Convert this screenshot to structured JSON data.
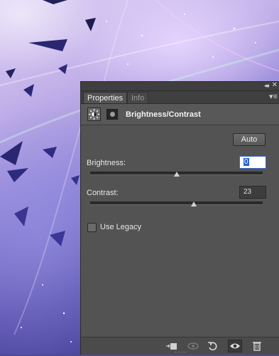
{
  "panel": {
    "tabs": [
      {
        "label": "Properties"
      },
      {
        "label": "Info"
      }
    ],
    "adjustment_title": "Brightness/Contrast",
    "auto_label": "Auto",
    "brightness": {
      "label": "Brightness:",
      "value": "0",
      "slider_fraction": 0.5
    },
    "contrast": {
      "label": "Contrast:",
      "value": "23",
      "slider_fraction": 0.6
    },
    "use_legacy": {
      "label": "Use Legacy",
      "checked": false
    }
  },
  "icons": {
    "collapse": "double-chevron-right-icon",
    "close": "close-icon",
    "menu": "panel-menu-icon",
    "adjustment": "brightness-sun-icon",
    "mask": "layer-mask-icon",
    "clip": "clip-to-layer-icon",
    "view_previous": "view-previous-state-icon",
    "reset": "reset-icon",
    "visibility": "eye-icon",
    "delete": "trash-icon"
  },
  "colors": {
    "panel_bg": "#535353",
    "header_bg": "#3f3f3f",
    "selection": "#2a5fd8"
  }
}
